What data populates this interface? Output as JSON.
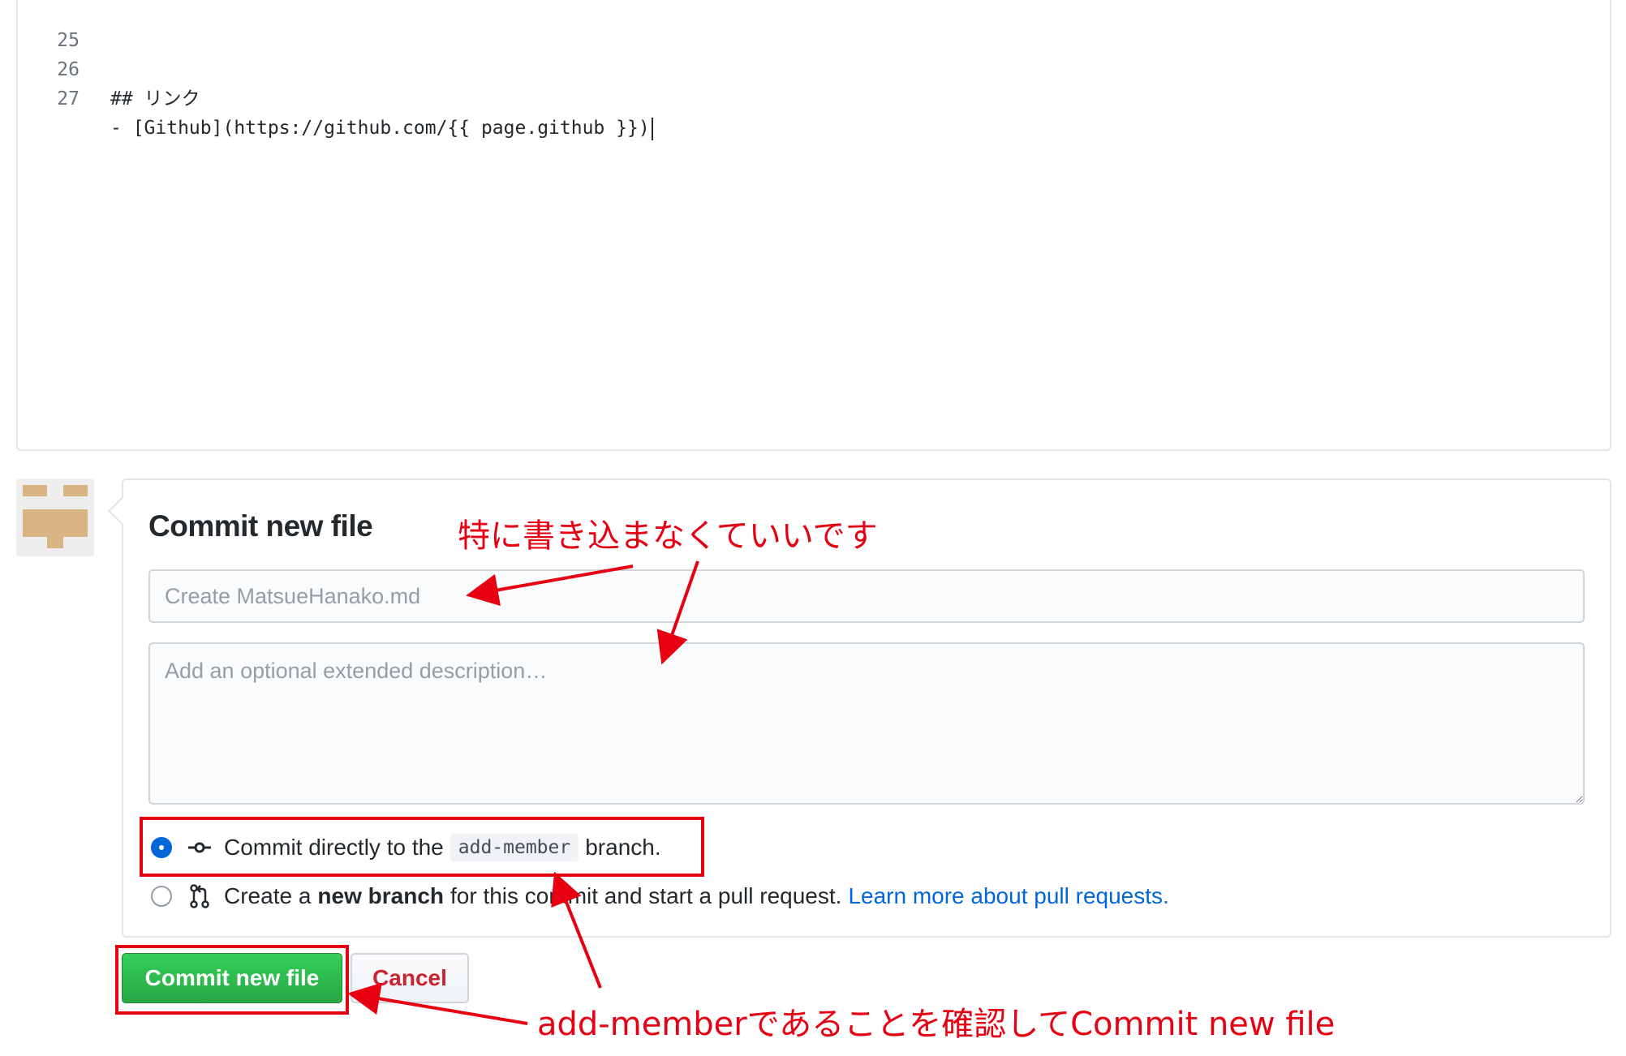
{
  "editor": {
    "lines": [
      {
        "number": "25",
        "text": ""
      },
      {
        "number": "26",
        "text": "## リンク"
      },
      {
        "number": "27",
        "text": "- [Github](https://github.com/{{ page.github }})"
      }
    ]
  },
  "commit": {
    "title": "Commit new file",
    "summary_placeholder": "Create MatsueHanako.md",
    "description_placeholder": "Add an optional extended description…",
    "option_direct": {
      "prefix": "Commit directly to the",
      "branch": "add-member",
      "suffix": "branch.",
      "selected": true
    },
    "option_new_branch": {
      "prefix": "Create a",
      "bold": "new branch",
      "suffix": "for this commit and start a pull request.",
      "link": "Learn more about pull requests.",
      "selected": false
    },
    "commit_button": "Commit new file",
    "cancel_button": "Cancel"
  },
  "annotations": {
    "note_top": "特に書き込まなくていいです",
    "note_bottom": "add-memberであることを確認してCommit new file"
  },
  "colors": {
    "annotation": "#e60012",
    "primary_button": "#28a745",
    "link": "#0366d6",
    "selected_radio": "#0366d6"
  }
}
